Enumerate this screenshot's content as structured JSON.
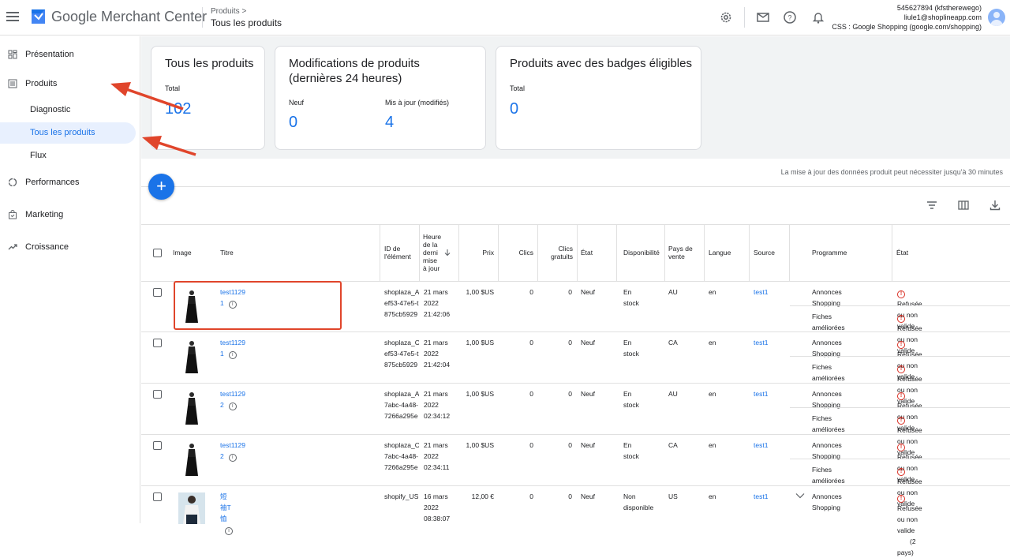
{
  "header": {
    "brand": "Google Merchant Center",
    "breadcrumb_parent": "Produits >",
    "breadcrumb_current": "Tous les produits",
    "account_id": "545627894 (kfstherewego)",
    "account_email": "liule1@shoplineapp.com",
    "account_css": "CSS : Google Shopping (google.com/shopping)",
    "icons": [
      "settings-icon",
      "mail-icon",
      "help-icon",
      "notifications-icon",
      "avatar"
    ]
  },
  "sidebar": {
    "items": [
      {
        "label": "Présentation",
        "icon": "dashboard-icon"
      },
      {
        "label": "Produits",
        "icon": "list-icon"
      },
      {
        "label": "Performances",
        "icon": "donut-icon"
      },
      {
        "label": "Marketing",
        "icon": "bag-icon"
      },
      {
        "label": "Croissance",
        "icon": "trend-icon"
      }
    ],
    "subitems": [
      {
        "label": "Diagnostic"
      },
      {
        "label": "Tous les produits"
      },
      {
        "label": "Flux"
      }
    ]
  },
  "cards": {
    "all": {
      "title": "Tous les produits",
      "total_label": "Total",
      "total_value": "102"
    },
    "mods": {
      "title_line1": "Modifications de produits",
      "title_line2": "(dernières 24 heures)",
      "new_label": "Neuf",
      "new_value": "0",
      "updated_label": "Mis à jour (modifiés)",
      "updated_value": "4"
    },
    "badges": {
      "title": "Produits avec des badges éligibles",
      "total_label": "Total",
      "total_value": "0"
    }
  },
  "notice": "La mise à jour des données produit peut nécessiter jusqu'à 30 minutes",
  "fab_label": "+",
  "table": {
    "headers": {
      "image": "Image",
      "title": "Titre",
      "id": "ID de l'élément",
      "updated": "Heure de la derni mise à jour",
      "price": "Prix",
      "clicks": "Clics",
      "free_clicks": "Clics gratuits",
      "condition": "État",
      "availability": "Disponibilité",
      "country": "Pays de vente",
      "language": "Langue",
      "source": "Source",
      "program": "Programme",
      "status": "État"
    },
    "rows": [
      {
        "title": "test1129 1",
        "id1": "shoplaza_A",
        "id2": "ef53-47e5-t",
        "id3": "875cb5929",
        "date1": "21 mars",
        "date2": "2022",
        "date3": "21:42:06",
        "price": "1,00 $US",
        "clicks": "0",
        "free_clicks": "0",
        "condition": "Neuf",
        "availability": "En stock",
        "country": "AU",
        "language": "en",
        "source": "test1",
        "program1": "Annonces Shopping",
        "status1": "Refusée ou non valide",
        "program2": "Fiches améliorées",
        "status2": "Refusée ou non valide"
      },
      {
        "title": "test1129 1",
        "id1": "shoplaza_C",
        "id2": "ef53-47e5-t",
        "id3": "875cb5929",
        "date1": "21 mars",
        "date2": "2022",
        "date3": "21:42:04",
        "price": "1,00 $US",
        "clicks": "0",
        "free_clicks": "0",
        "condition": "Neuf",
        "availability": "En stock",
        "country": "CA",
        "language": "en",
        "source": "test1",
        "program1": "Annonces Shopping",
        "status1": "Refusée ou non valide",
        "program2": "Fiches améliorées",
        "status2": "Refusée ou non valide"
      },
      {
        "title": "test1129 2",
        "id1": "shoplaza_A",
        "id2": "7abc-4a48-",
        "id3": "7266a295e",
        "date1": "21 mars",
        "date2": "2022",
        "date3": "02:34:12",
        "price": "1,00 $US",
        "clicks": "0",
        "free_clicks": "0",
        "condition": "Neuf",
        "availability": "En stock",
        "country": "AU",
        "language": "en",
        "source": "test1",
        "program1": "Annonces Shopping",
        "status1": "Refusée ou non valide",
        "program2": "Fiches améliorées",
        "status2": "Refusée ou non valide"
      },
      {
        "title": "test1129 2",
        "id1": "shoplaza_C",
        "id2": "7abc-4a48-",
        "id3": "7266a295e",
        "date1": "21 mars",
        "date2": "2022",
        "date3": "02:34:11",
        "price": "1,00 $US",
        "clicks": "0",
        "free_clicks": "0",
        "condition": "Neuf",
        "availability": "En stock",
        "country": "CA",
        "language": "en",
        "source": "test1",
        "program1": "Annonces Shopping",
        "status1": "Refusée ou non valide",
        "program2": "Fiches améliorées",
        "status2": "Refusée ou non valide"
      },
      {
        "title": "短袖T恤",
        "id1": "shopify_US",
        "id2": "",
        "id3": "",
        "date1": "16 mars",
        "date2": "2022",
        "date3": "08:38:07",
        "price": "12,00 €",
        "clicks": "0",
        "free_clicks": "0",
        "condition": "Neuf",
        "availability1": "Non",
        "availability2": "disponible",
        "country": "US",
        "language": "en",
        "source": "test1",
        "program1": "Annonces Shopping",
        "status1": "Refusée ou non valide",
        "status1b": "(2 pays)"
      }
    ]
  },
  "colors": {
    "accent": "#1a73e8",
    "error": "#d93025",
    "annotation": "#e0452b",
    "selected_bg": "#e8f0fe"
  }
}
